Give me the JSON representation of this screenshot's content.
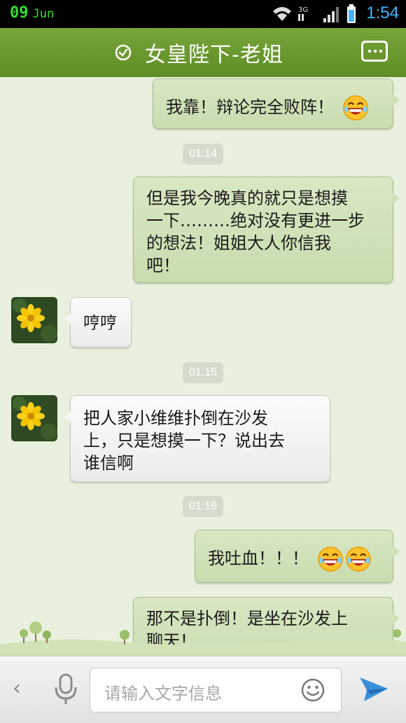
{
  "status_bar": {
    "date_day": "09",
    "date_month": "Jun",
    "network": "3G",
    "time": "1:54"
  },
  "header": {
    "title": "女皇陛下-老姐"
  },
  "messages": [
    {
      "sender": "me",
      "text": "我靠！辩论完全败阵！",
      "emoji": [
        "laughing-tears-emoji"
      ]
    },
    {
      "type": "timestamp",
      "text": "01:14"
    },
    {
      "sender": "me",
      "lines": [
        "但是我今晚真的就只是想摸",
        "一下………绝对没有更进一步",
        "的想法！姐姐大人你信我",
        "吧！"
      ]
    },
    {
      "sender": "other",
      "text": "哼哼"
    },
    {
      "type": "timestamp",
      "text": "01:15"
    },
    {
      "sender": "other",
      "lines": [
        "把人家小维维扑倒在沙发",
        "上，只是想摸一下？说出去",
        "谁信啊"
      ]
    },
    {
      "type": "timestamp",
      "text": "01:16"
    },
    {
      "sender": "me",
      "text": "我吐血！！！",
      "emoji": [
        "laughing-tears-emoji",
        "laughing-tears-emoji"
      ]
    },
    {
      "sender": "me",
      "lines": [
        "那不是扑倒！是坐在沙发上",
        "聊天！"
      ]
    }
  ],
  "input_bar": {
    "back_label": "‹",
    "placeholder": "请输入文字信息"
  },
  "colors": {
    "header_green": "#6c9a2e",
    "chat_background": "#e9f1de",
    "my_bubble": "#d4e5bd",
    "other_bubble": "#f4f4f4",
    "timestamp_bg": "#d5dccd",
    "send_icon": "#3a8fd9"
  }
}
